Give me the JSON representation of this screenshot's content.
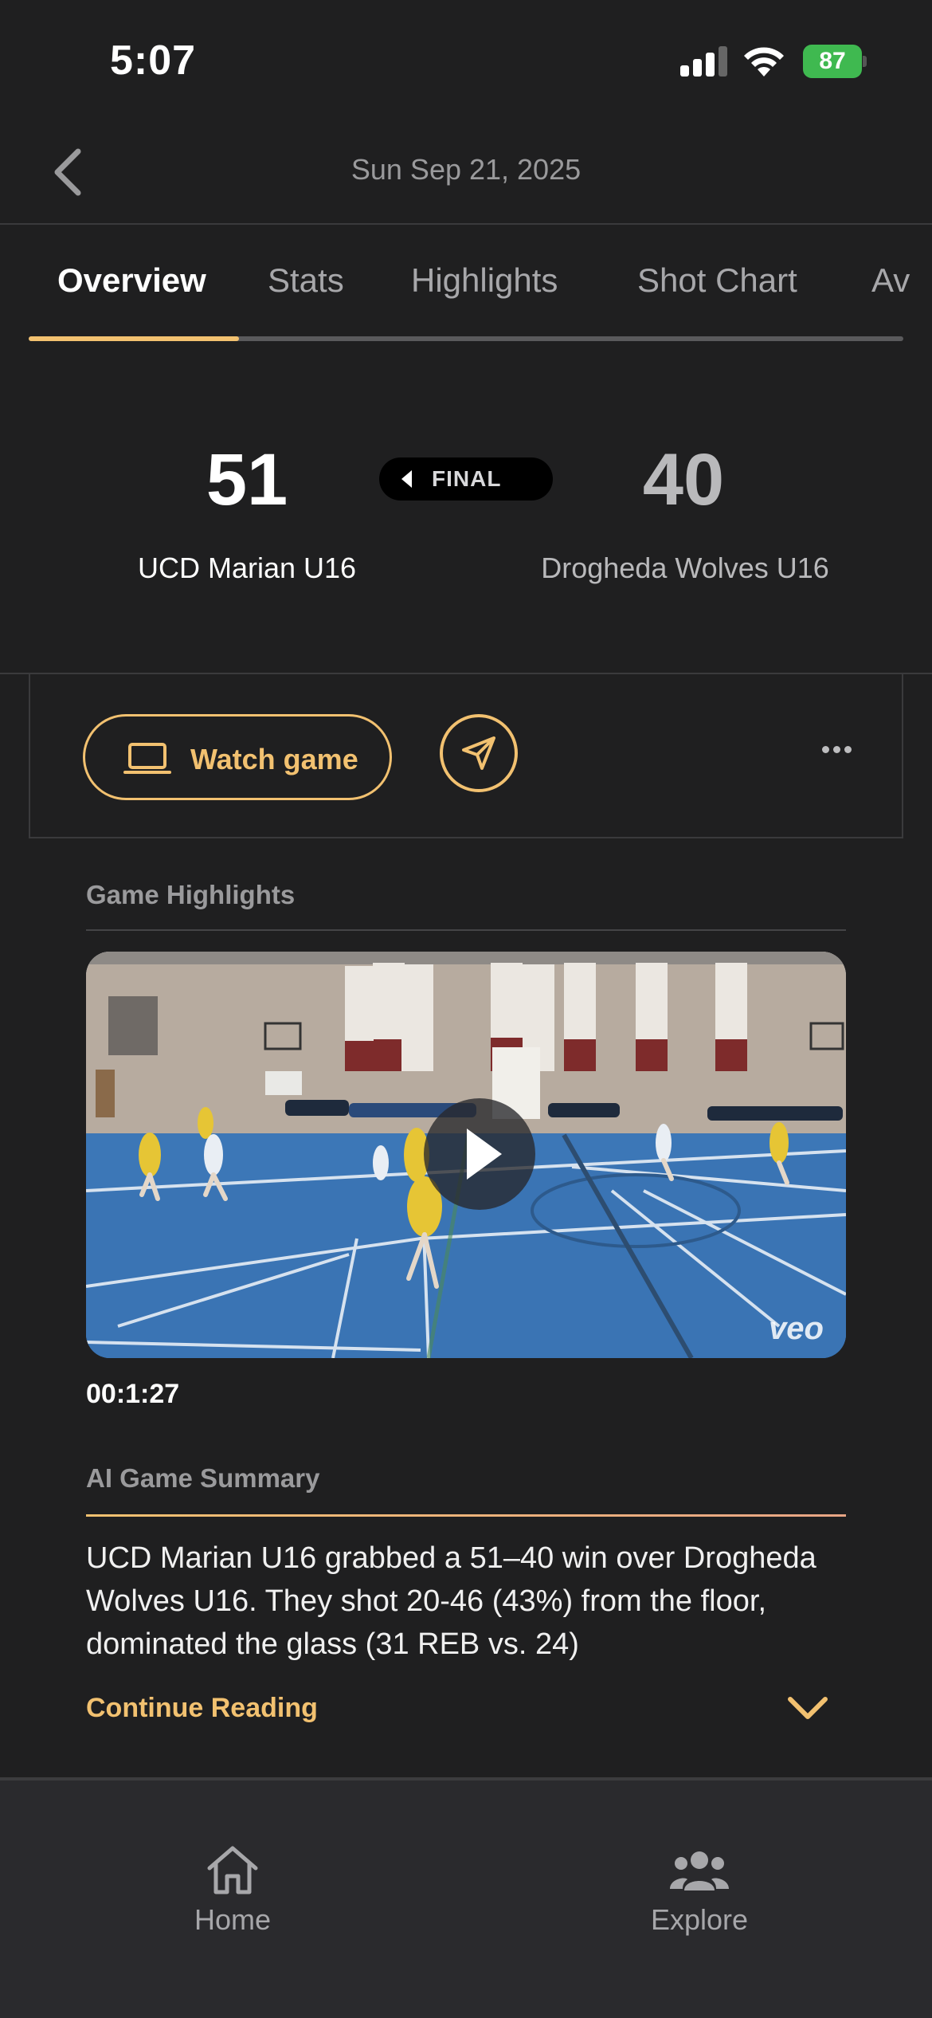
{
  "status_bar": {
    "time": "5:07",
    "battery": "87"
  },
  "nav": {
    "date": "Sun Sep 21, 2025",
    "back_icon": "chevron-left-icon"
  },
  "tabs": [
    {
      "label": "Overview",
      "active": true
    },
    {
      "label": "Stats",
      "active": false
    },
    {
      "label": "Highlights",
      "active": false
    },
    {
      "label": "Shot Chart",
      "active": false
    },
    {
      "label": "Av",
      "active": false
    }
  ],
  "game": {
    "home_team": "UCD Marian U16",
    "home_score": "51",
    "away_team": "Drogheda Wolves U16",
    "away_score": "40",
    "status": "FINAL"
  },
  "actions": {
    "watch_label": "Watch game",
    "watch_icon": "laptop-icon",
    "share_icon": "send-icon",
    "more_icon": "more-horizontal-icon"
  },
  "highlights": {
    "title": "Game Highlights",
    "duration": "00:1:27",
    "watermark": "veo"
  },
  "summary": {
    "title": "AI Game Summary",
    "text": "UCD Marian U16 grabbed a 51–40 win over Drogheda Wolves U16. They shot 20-46 (43%) from the floor, dominated the glass (31 REB vs. 24)",
    "continue_label": "Continue Reading"
  },
  "bottom_tabs": [
    {
      "label": "Home",
      "icon": "home-icon"
    },
    {
      "label": "Explore",
      "icon": "people-icon"
    }
  ],
  "colors": {
    "accent": "#f2c170",
    "background": "#1f1f20",
    "battery": "#3fb950"
  }
}
